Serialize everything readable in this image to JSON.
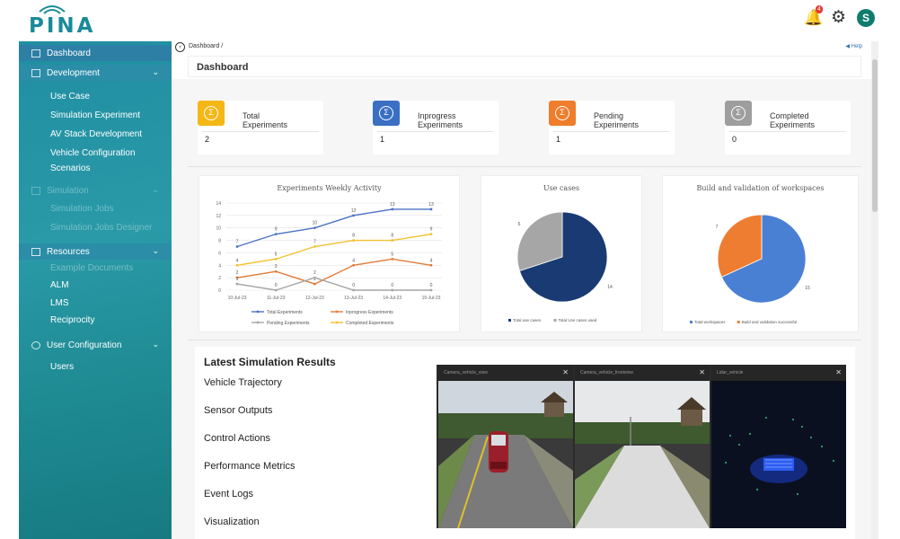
{
  "app": {
    "logo_text": "PINA"
  },
  "header": {
    "notification_count": "4",
    "avatar_letter": "S"
  },
  "sidebar": {
    "dashboard": "Dashboard",
    "development": {
      "label": "Development",
      "items": [
        "Use Case",
        "Simulation Experiment",
        "AV Stack Development",
        "Vehicle Configuration",
        "Scenarios"
      ]
    },
    "simulation": {
      "label": "Simulation",
      "items": [
        "Simulation Jobs",
        "Simulation Jobs Designer"
      ]
    },
    "resources": {
      "label": "Resources",
      "items": [
        "Example Documents",
        "ALM",
        "LMS",
        "Reciprocity"
      ]
    },
    "user_configuration": {
      "label": "User Configuration",
      "items": [
        "Users"
      ]
    }
  },
  "breadcrumb": {
    "path": "Dashboard /",
    "help": "Help"
  },
  "page_title": "Dashboard",
  "stat_cards": [
    {
      "label_line1": "Total",
      "label_line2": "Experiments",
      "value": "2",
      "color": "#f5b716"
    },
    {
      "label_line1": "Inprogress",
      "label_line2": "Experiments",
      "value": "1",
      "color": "#3a6fc4"
    },
    {
      "label_line1": "Pending",
      "label_line2": "Experiments",
      "value": "1",
      "color": "#ef7d2b"
    },
    {
      "label_line1": "Completed",
      "label_line2": "Experiments",
      "value": "0",
      "color": "#9e9e9e"
    }
  ],
  "chart_data": [
    {
      "type": "line",
      "title": "Experiments Weekly Activity",
      "categories": [
        "10-Jul-23",
        "11-Jul-23",
        "12-Jul-23",
        "13-Jul-23",
        "14-Jul-23",
        "15-Jul-23"
      ],
      "ylim": [
        0,
        14
      ],
      "yticks": [
        0,
        2,
        4,
        6,
        8,
        10,
        12,
        14
      ],
      "grid": true,
      "legend_position": "bottom",
      "series": [
        {
          "name": "Total Experiments",
          "values": [
            7,
            9,
            10,
            12,
            13,
            13
          ],
          "color": "#4a72c4"
        },
        {
          "name": "Inprogress Experiments",
          "values": [
            2,
            3,
            1,
            4,
            5,
            4
          ],
          "color": "#e07b39"
        },
        {
          "name": "Pending Experiments",
          "values": [
            1,
            0,
            2,
            0,
            0,
            0
          ],
          "color": "#a5a5a5"
        },
        {
          "name": "Completed Experiments",
          "values": [
            4,
            5,
            7,
            8,
            8,
            9
          ],
          "color": "#f2c12e"
        }
      ]
    },
    {
      "type": "pie",
      "title": "Use cases",
      "legend_position": "bottom",
      "slices": [
        {
          "name": "Total use cases",
          "value": 14,
          "color": "#1a3a73"
        },
        {
          "name": "Total Use cases used",
          "value": 6,
          "color": "#a6a6a6"
        }
      ]
    },
    {
      "type": "pie",
      "title": "Build and validation of workspaces",
      "legend_position": "bottom",
      "slices": [
        {
          "name": "Total workspaces",
          "value": 15,
          "color": "#4a80d4"
        },
        {
          "name": "Build and validation successful",
          "value": 7,
          "color": "#ee7d31"
        }
      ]
    }
  ],
  "results": {
    "title": "Latest Simulation Results",
    "items": [
      "Vehicle Trajectory",
      "Sensor Outputs",
      "Control Actions",
      "Performance Metrics",
      "Event Logs",
      "Visualization"
    ]
  },
  "sim_views": [
    {
      "label": "Camera_vehicle_view"
    },
    {
      "label": "Camera_vehicle_frontview"
    },
    {
      "label": "Lidar_vehicle"
    }
  ]
}
